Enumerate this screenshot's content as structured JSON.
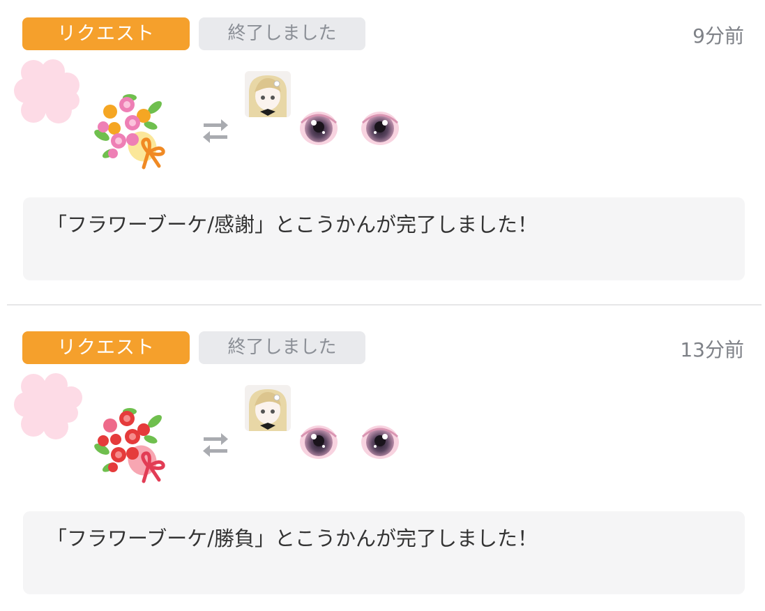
{
  "entries": [
    {
      "badge_label": "リクエスト",
      "status_label": "終了しました",
      "time": "9分前",
      "gift_icon": "bouquet-icon",
      "message": "「フラワーブーケ/感謝」とこうかんが完了しました！"
    },
    {
      "badge_label": "リクエスト",
      "status_label": "終了しました",
      "time": "13分前",
      "gift_icon": "bouquet-icon",
      "message": "「フラワーブーケ/勝負」とこうかんが完了しました！"
    }
  ],
  "colors": {
    "badge_orange": "#f5a02c",
    "status_gray": "#e9eaed",
    "message_bg": "#f5f5f6",
    "blur_pink": "#fddbe6"
  }
}
